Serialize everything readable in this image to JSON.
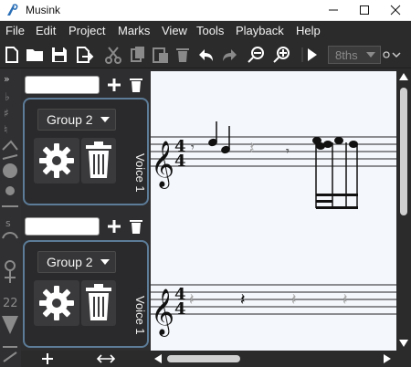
{
  "window": {
    "title": "Musink",
    "minimize_icon": "minimize-icon",
    "maximize_icon": "maximize-icon",
    "close_icon": "close-icon"
  },
  "menu": {
    "items": [
      "File",
      "Edit",
      "Project",
      "Marks",
      "View",
      "Tools",
      "Playback",
      "Help"
    ]
  },
  "toolbar": {
    "icons": [
      "new-file-icon",
      "open-folder-icon",
      "save-icon",
      "export-icon",
      "cut-icon",
      "copy-icon",
      "paste-icon",
      "delete-icon",
      "undo-icon",
      "redo-icon",
      "zoom-out-icon",
      "zoom-in-icon",
      "play-icon"
    ],
    "note_length_value": "8ths"
  },
  "voices": [
    {
      "name_value": "",
      "group_value": "Group 2",
      "label": "Voice 1"
    },
    {
      "name_value": "",
      "group_value": "Group 2",
      "label": "Voice 1"
    }
  ],
  "score": {
    "time_signature_top": "4",
    "time_signature_bottom": "4"
  },
  "colors": {
    "app_background": "#2e2e30",
    "score_background": "#f4f7fc",
    "voice_border": "#5c7c98",
    "ghost_note": "#a9a9a9"
  }
}
